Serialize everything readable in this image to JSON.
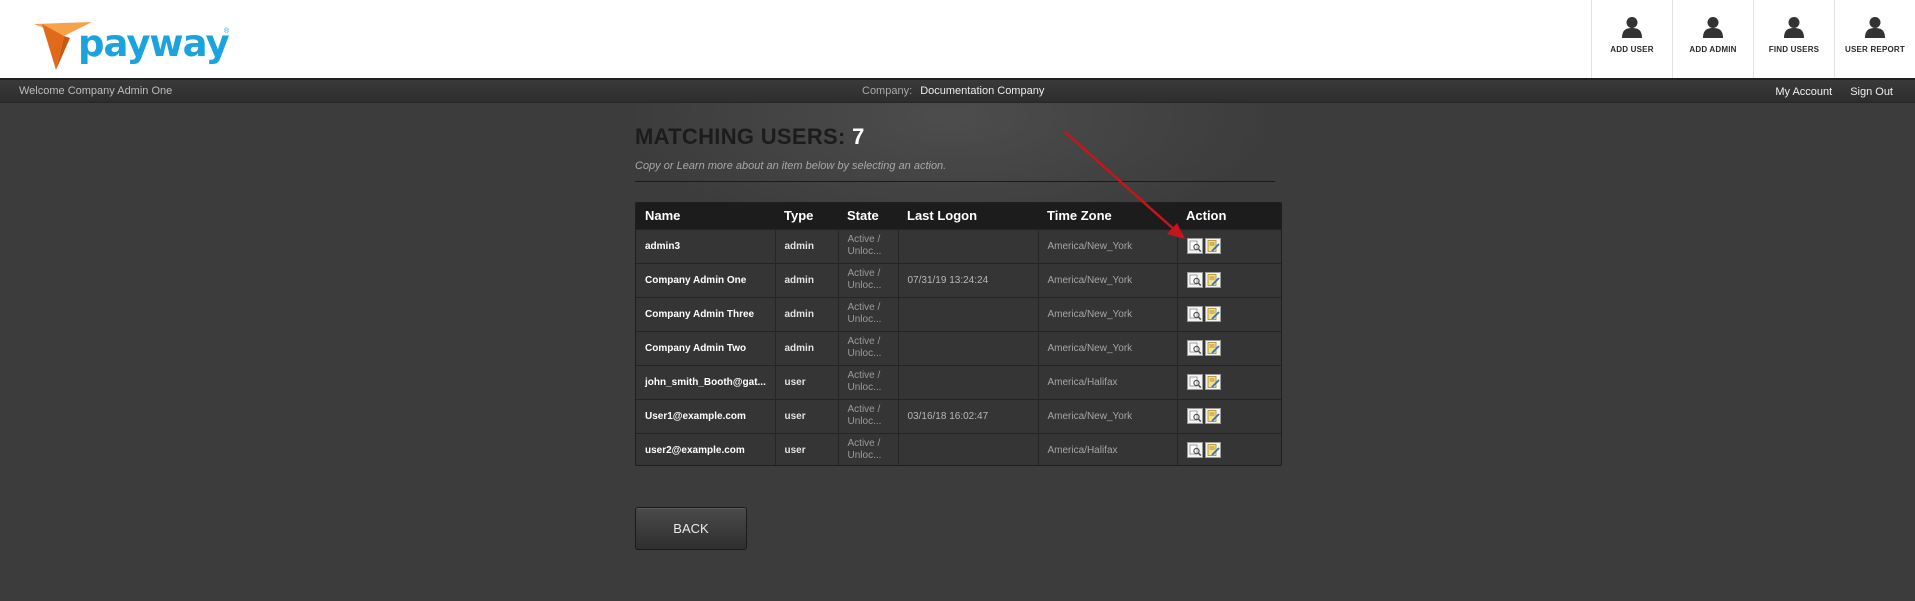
{
  "brand": {
    "name": "payway",
    "registered_mark": "®"
  },
  "toolbar": [
    {
      "label": "ADD USER",
      "icon": "person-icon"
    },
    {
      "label": "ADD ADMIN",
      "icon": "person-icon"
    },
    {
      "label": "FIND USERS",
      "icon": "person-icon"
    },
    {
      "label": "USER REPORT",
      "icon": "person-icon"
    }
  ],
  "infobar": {
    "welcome": "Welcome Company Admin One",
    "company_label": "Company:",
    "company_name": "Documentation Company",
    "my_account": "My Account",
    "sign_out": "Sign Out"
  },
  "page": {
    "title": "MATCHING USERS:",
    "count": "7",
    "subtitle": "Copy or Learn more about an item below by selecting an action."
  },
  "table": {
    "columns": [
      "Name",
      "Type",
      "State",
      "Last Logon",
      "Time Zone",
      "Action"
    ],
    "rows": [
      {
        "name": "admin3",
        "type": "admin",
        "state": "Active / Unloc...",
        "last_logon": "",
        "time_zone": "America/New_York"
      },
      {
        "name": "Company Admin One",
        "type": "admin",
        "state": "Active / Unloc...",
        "last_logon": "07/31/19 13:24:24",
        "time_zone": "America/New_York"
      },
      {
        "name": "Company Admin Three",
        "type": "admin",
        "state": "Active / Unloc...",
        "last_logon": "",
        "time_zone": "America/New_York"
      },
      {
        "name": "Company Admin Two",
        "type": "admin",
        "state": "Active / Unloc...",
        "last_logon": "",
        "time_zone": "America/New_York"
      },
      {
        "name": "john_smith_Booth@gat...",
        "type": "user",
        "state": "Active / Unloc...",
        "last_logon": "",
        "time_zone": "America/Halifax"
      },
      {
        "name": "User1@example.com",
        "type": "user",
        "state": "Active / Unloc...",
        "last_logon": "03/16/18 16:02:47",
        "time_zone": "America/New_York"
      },
      {
        "name": "user2@example.com",
        "type": "user",
        "state": "Active / Unloc...",
        "last_logon": "",
        "time_zone": "America/Halifax"
      }
    ],
    "action_icons": [
      "view-detail-icon",
      "edit-note-icon"
    ]
  },
  "back_label": "BACK",
  "colors": {
    "brand_blue": "#1aa3dc",
    "brand_orange": "#f2852b",
    "annotation_red": "#c8141c"
  }
}
